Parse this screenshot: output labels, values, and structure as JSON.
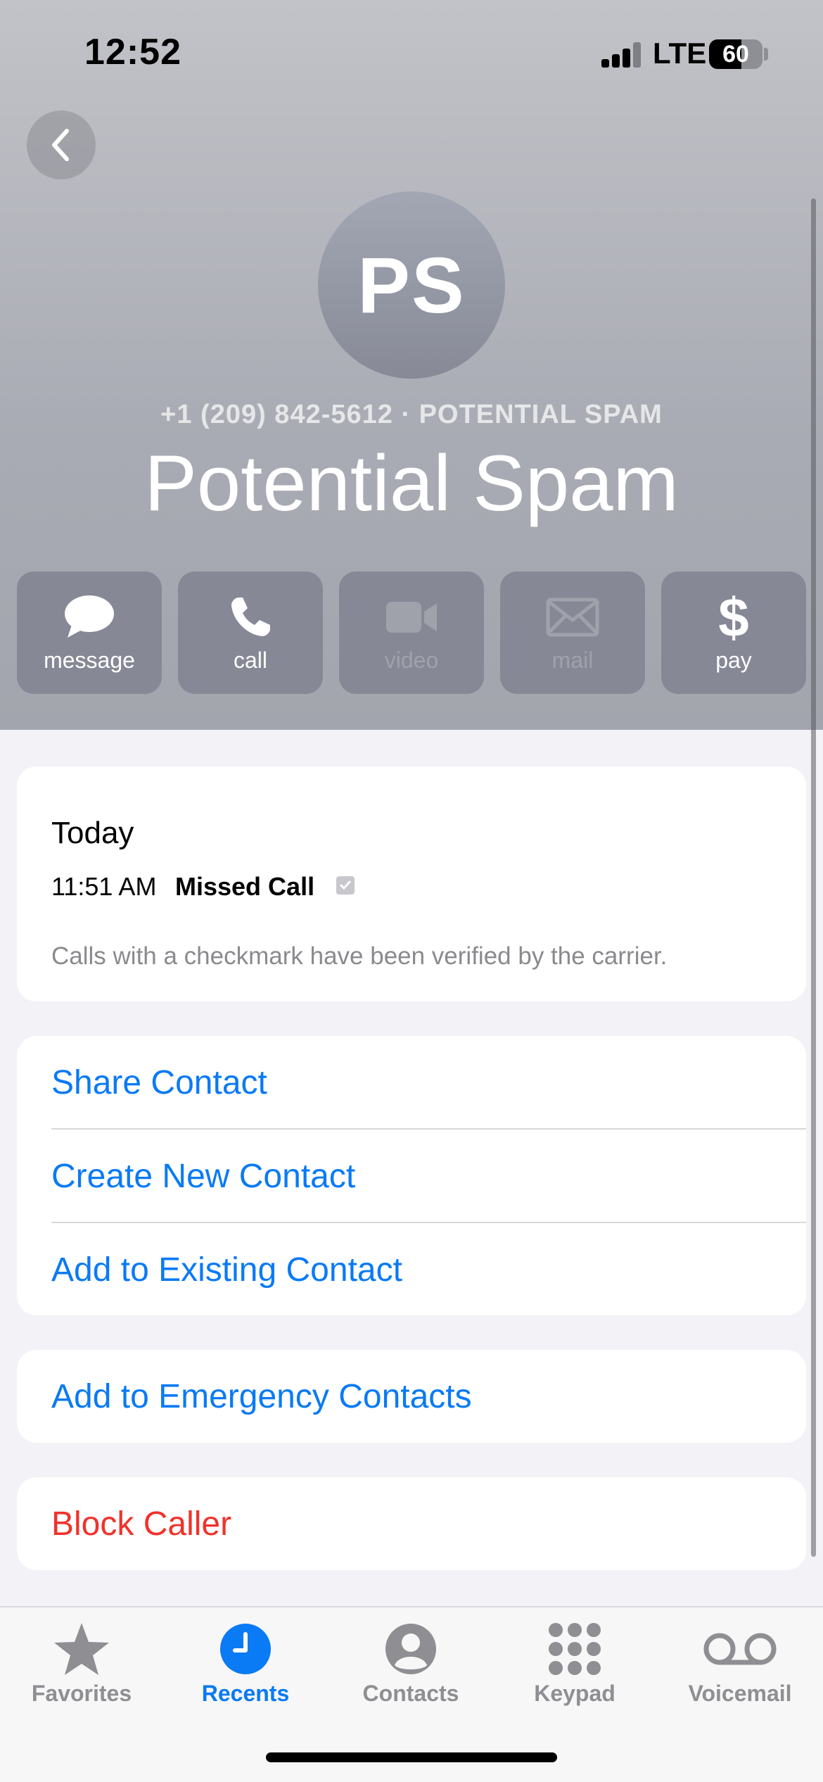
{
  "status_bar": {
    "time": "12:52",
    "network": "LTE",
    "battery": "60",
    "battery_level": 0.6
  },
  "header": {
    "initials": "PS",
    "subtitle": "+1 (209) 842-5612 · POTENTIAL SPAM",
    "name": "Potential Spam"
  },
  "actions": [
    {
      "label": "message",
      "icon": "message-icon",
      "enabled": true
    },
    {
      "label": "call",
      "icon": "phone-icon",
      "enabled": true
    },
    {
      "label": "video",
      "icon": "video-icon",
      "enabled": false
    },
    {
      "label": "mail",
      "icon": "mail-icon",
      "enabled": false
    },
    {
      "label": "pay",
      "icon": "dollar-icon",
      "enabled": true
    }
  ],
  "history": {
    "day": "Today",
    "entry": {
      "time": "11:51 AM",
      "type": "Missed Call",
      "verified": true
    },
    "note": "Calls with a checkmark have been verified by the carrier."
  },
  "contact_options": [
    "Share Contact",
    "Create New Contact",
    "Add to Existing Contact"
  ],
  "emergency": "Add to Emergency Contacts",
  "block": "Block Caller",
  "colors": {
    "accent": "#0a7af5",
    "destructive": "#f0322b"
  },
  "tabs": [
    {
      "label": "Favorites",
      "icon": "star-icon",
      "active": false
    },
    {
      "label": "Recents",
      "icon": "clock-icon",
      "active": true
    },
    {
      "label": "Contacts",
      "icon": "person-icon",
      "active": false
    },
    {
      "label": "Keypad",
      "icon": "keypad-icon",
      "active": false
    },
    {
      "label": "Voicemail",
      "icon": "voicemail-icon",
      "active": false
    }
  ]
}
